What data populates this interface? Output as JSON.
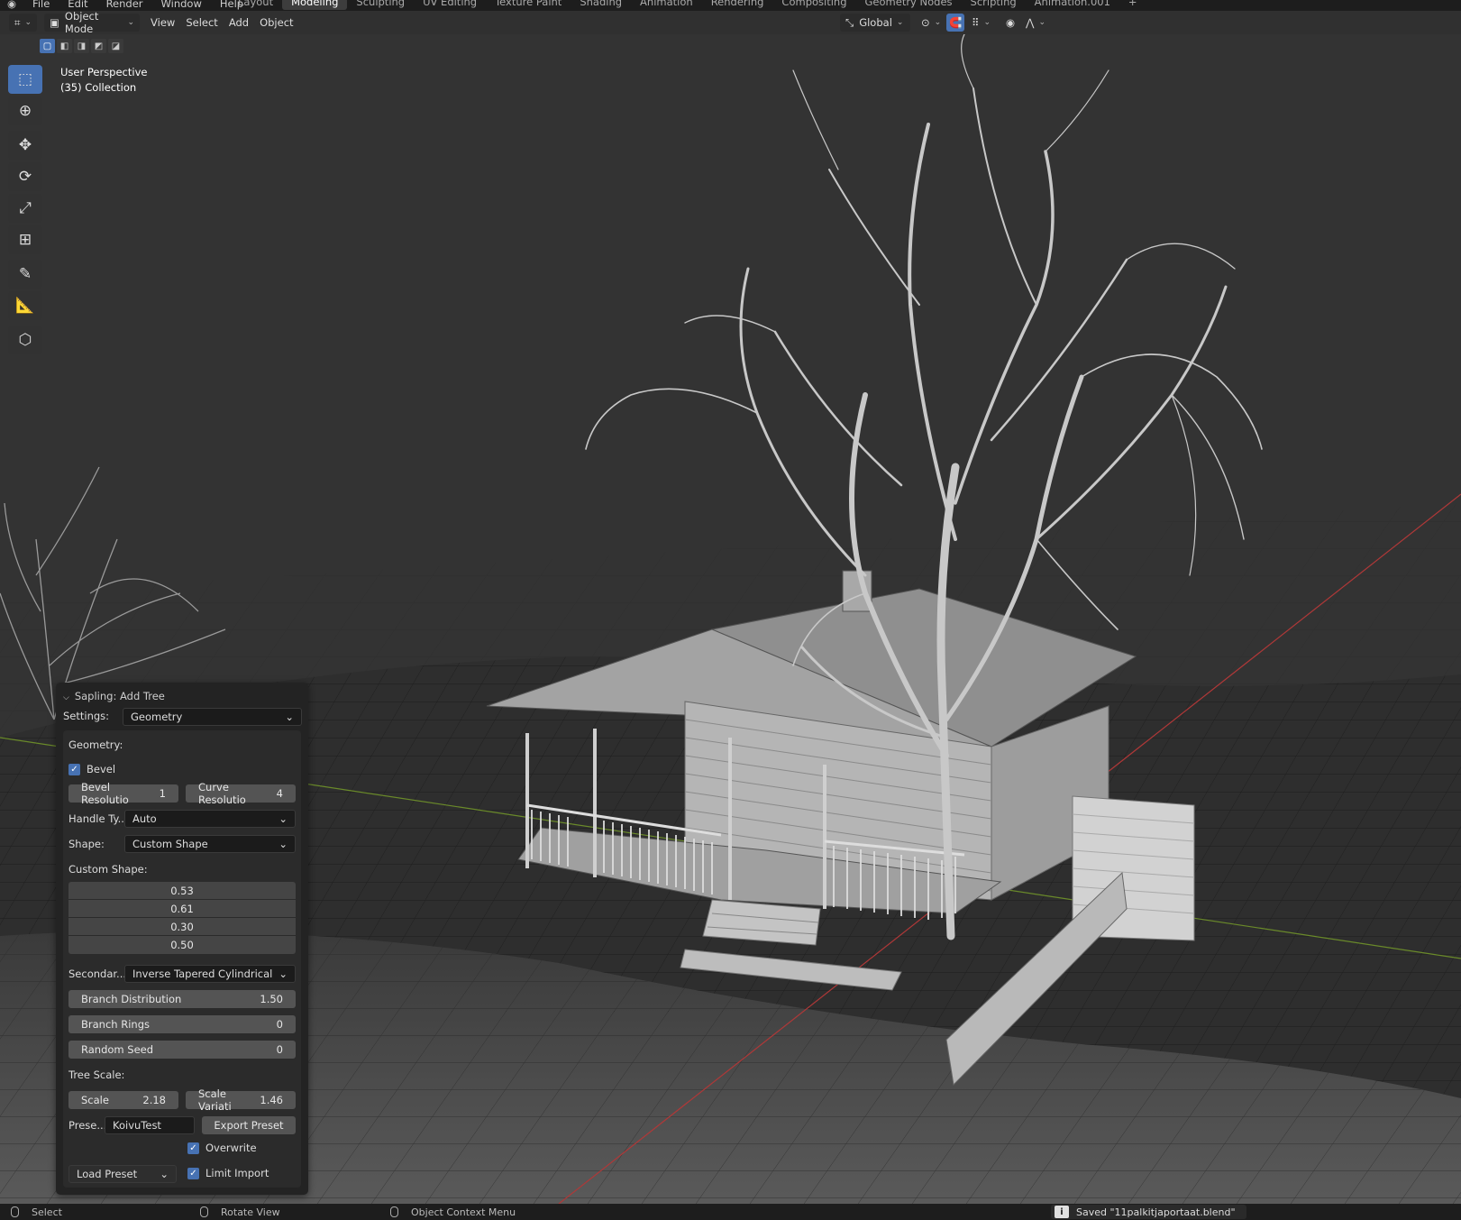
{
  "top_menu": {
    "items": [
      "File",
      "Edit",
      "Render",
      "Window",
      "Help"
    ],
    "workspaces": [
      "Layout",
      "Modeling",
      "Sculpting",
      "UV Editing",
      "Texture Paint",
      "Shading",
      "Animation",
      "Rendering",
      "Compositing",
      "Geometry Nodes",
      "Scripting",
      "Animation.001"
    ],
    "active_workspace": "Modeling",
    "add_tab": "+"
  },
  "header": {
    "mode": "Object Mode",
    "menus": [
      "View",
      "Select",
      "Add",
      "Object"
    ],
    "orientation": "Global"
  },
  "viewport": {
    "view_name": "User Perspective",
    "collection": "(35) Collection"
  },
  "toolbar": {
    "tools": [
      "select-box-icon",
      "cursor-icon",
      "move-icon",
      "rotate-icon",
      "scale-icon",
      "transform-icon",
      "annotate-icon",
      "measure-icon",
      "add-cube-icon"
    ]
  },
  "panel": {
    "title": "Sapling: Add Tree",
    "settings_label": "Settings:",
    "settings_value": "Geometry",
    "geometry_label": "Geometry:",
    "bevel_label": "Bevel",
    "bevel_checked": true,
    "bevel_resolution_label": "Bevel Resolutio",
    "bevel_resolution_value": "1",
    "curve_resolution_label": "Curve Resolutio",
    "curve_resolution_value": "4",
    "handle_type_label": "Handle Ty...",
    "handle_type_value": "Auto",
    "shape_label": "Shape:",
    "shape_value": "Custom Shape",
    "custom_shape_label": "Custom Shape:",
    "custom_shape_values": [
      "0.53",
      "0.61",
      "0.30",
      "0.50"
    ],
    "secondary_label": "Secondar...",
    "secondary_value": "Inverse Tapered Cylindrical",
    "branch_distribution_label": "Branch Distribution",
    "branch_distribution_value": "1.50",
    "branch_rings_label": "Branch Rings",
    "branch_rings_value": "0",
    "random_seed_label": "Random Seed",
    "random_seed_value": "0",
    "tree_scale_label": "Tree Scale:",
    "scale_label": "Scale",
    "scale_value": "2.18",
    "scale_variation_label": "Scale Variati",
    "scale_variation_value": "1.46",
    "preset_label": "Prese...",
    "preset_value": "KoivuTest",
    "export_preset_label": "Export Preset",
    "overwrite_label": "Overwrite",
    "overwrite_checked": true,
    "load_preset_label": "Load Preset",
    "limit_import_label": "Limit Import",
    "limit_import_checked": true
  },
  "statusbar": {
    "select": "Select",
    "rotate_view": "Rotate View",
    "context_menu": "Object Context Menu",
    "saved_message": "Saved \"11palkitjaportaat.blend\""
  },
  "colors": {
    "accent": "#4772b3",
    "background": "#303030",
    "panel": "#232323"
  }
}
